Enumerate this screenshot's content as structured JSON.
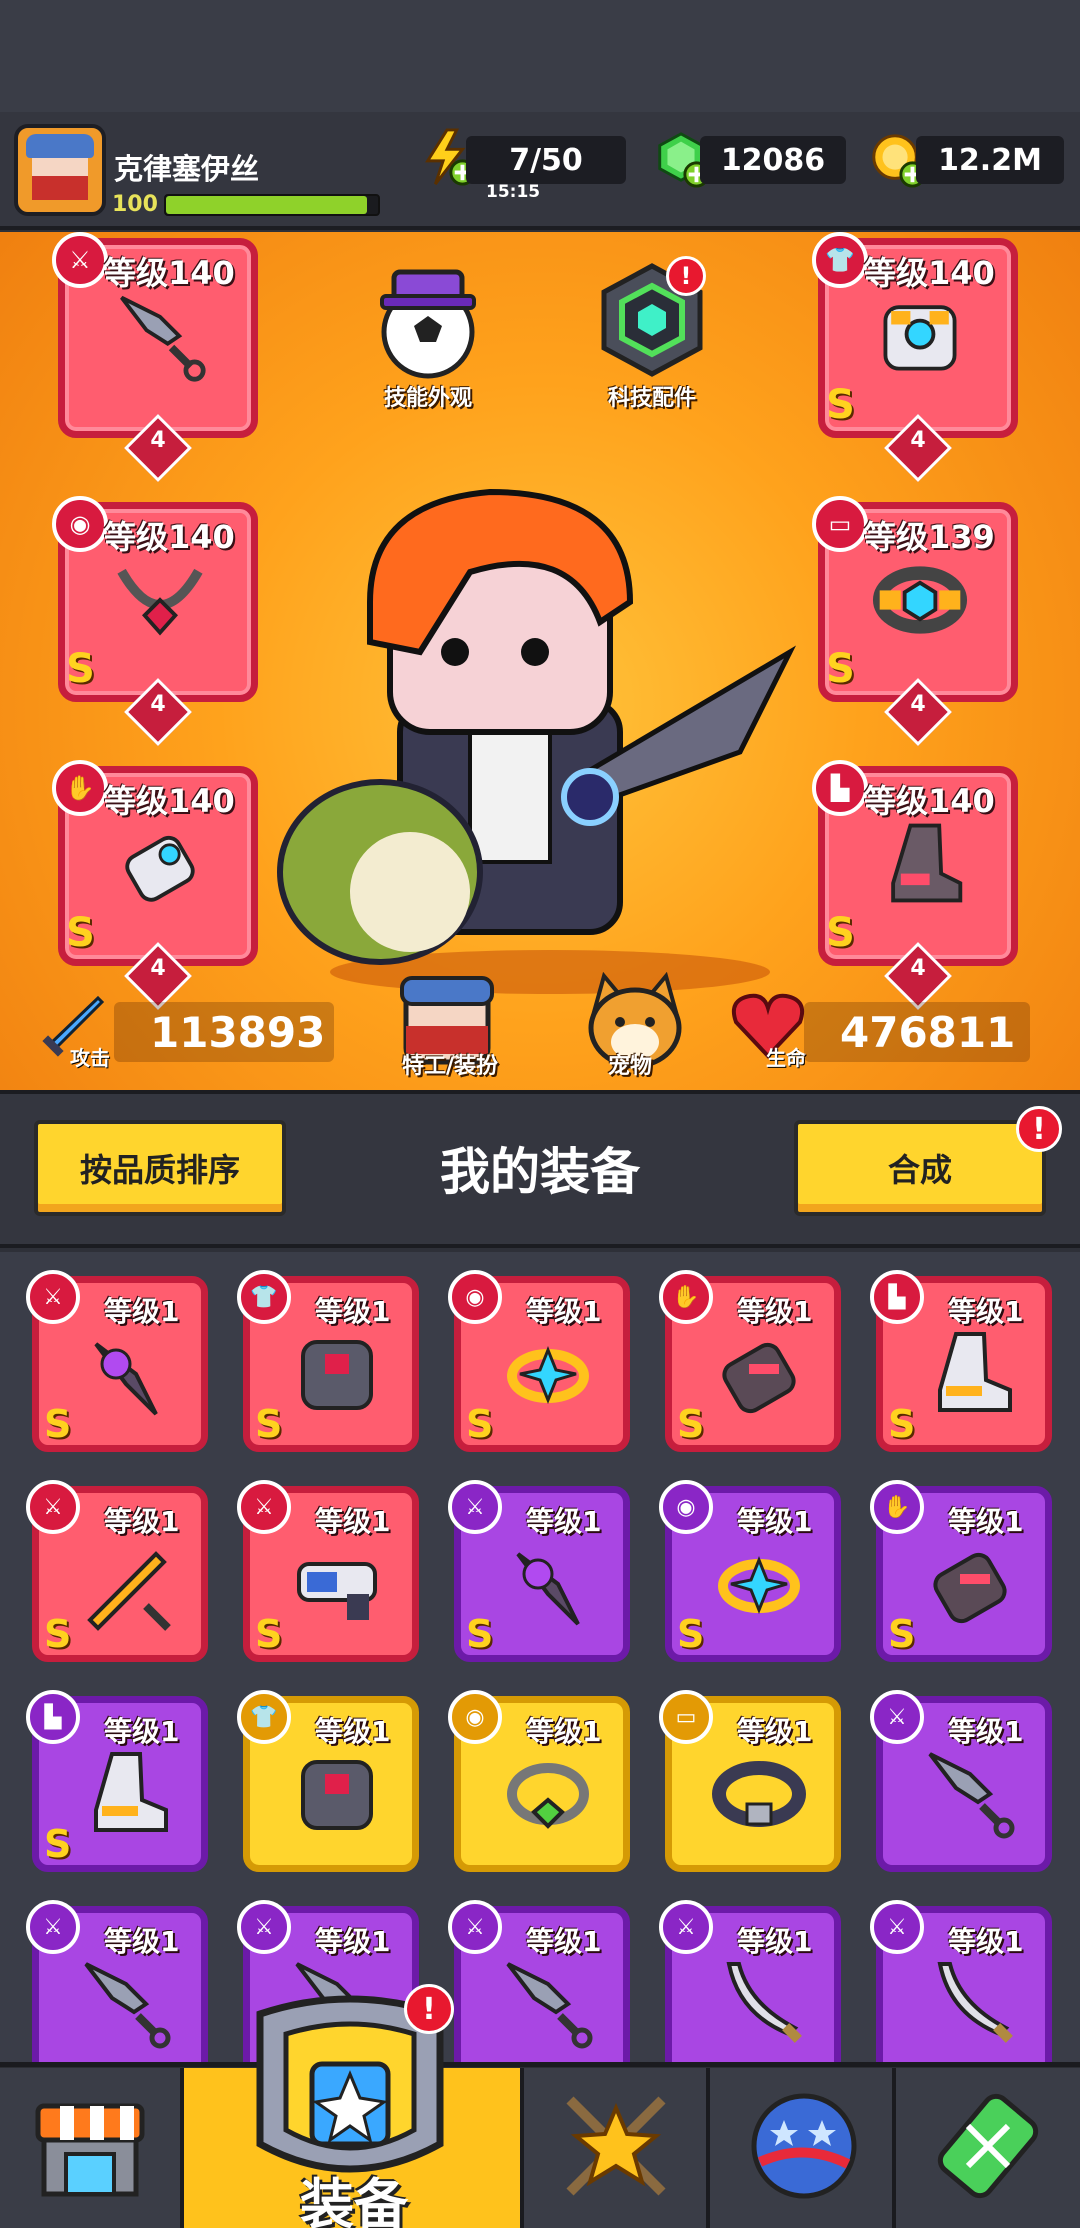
{
  "player": {
    "name": "克律塞伊丝",
    "level": "100",
    "xp_fraction": 0.95
  },
  "resources": {
    "energy": "7/50",
    "energy_timer": "15:15",
    "gems": "12086",
    "coins": "12.2M"
  },
  "equipped": [
    {
      "slot": "weapon",
      "level": "等级140",
      "grade": "",
      "stars": "4",
      "icon": "kunai-icon"
    },
    {
      "slot": "armor",
      "level": "等级140",
      "grade": "S",
      "stars": "4",
      "icon": "armor-icon"
    },
    {
      "slot": "necklace",
      "level": "等级140",
      "grade": "S",
      "stars": "4",
      "icon": "necklace-icon"
    },
    {
      "slot": "belt",
      "level": "等级139",
      "grade": "S",
      "stars": "4",
      "icon": "belt-icon"
    },
    {
      "slot": "gloves",
      "level": "等级140",
      "grade": "S",
      "stars": "4",
      "icon": "glove-icon"
    },
    {
      "slot": "boots",
      "level": "等级140",
      "grade": "S",
      "stars": "4",
      "icon": "boot-icon"
    }
  ],
  "center_buttons": {
    "skill_skin": "技能外观",
    "tech_parts": "科技配件",
    "agent_outfit": "特工/装扮",
    "pet": "宠物"
  },
  "stats": {
    "attack_label": "攻击",
    "attack": "113893",
    "hp_label": "生命",
    "hp": "476811"
  },
  "section": {
    "sort_button": "按品质排序",
    "title": "我的装备",
    "merge_button": "合成",
    "alert": "!"
  },
  "inventory": [
    {
      "rarity": "red",
      "level": "等级1",
      "grade": "S",
      "icon": "dagger-icon"
    },
    {
      "rarity": "red",
      "level": "等级1",
      "grade": "S",
      "icon": "armor-icon"
    },
    {
      "rarity": "red",
      "level": "等级1",
      "grade": "S",
      "icon": "ring-icon"
    },
    {
      "rarity": "red",
      "level": "等级1",
      "grade": "S",
      "icon": "glove-icon"
    },
    {
      "rarity": "red",
      "level": "等级1",
      "grade": "S",
      "icon": "boot-icon"
    },
    {
      "rarity": "red",
      "level": "等级1",
      "grade": "S",
      "icon": "sword-icon"
    },
    {
      "rarity": "red",
      "level": "等级1",
      "grade": "S",
      "icon": "blaster-icon"
    },
    {
      "rarity": "purple",
      "level": "等级1",
      "grade": "S",
      "icon": "dagger-icon"
    },
    {
      "rarity": "purple",
      "level": "等级1",
      "grade": "S",
      "icon": "ring-icon"
    },
    {
      "rarity": "purple",
      "level": "等级1",
      "grade": "S",
      "icon": "glove-icon"
    },
    {
      "rarity": "purple",
      "level": "等级1",
      "grade": "S",
      "icon": "boot-icon"
    },
    {
      "rarity": "yellow",
      "level": "等级1",
      "grade": "",
      "icon": "armor-icon"
    },
    {
      "rarity": "yellow",
      "level": "等级1",
      "grade": "",
      "icon": "necklace-icon"
    },
    {
      "rarity": "yellow",
      "level": "等级1",
      "grade": "",
      "icon": "belt-icon"
    },
    {
      "rarity": "purple",
      "level": "等级1",
      "grade": "",
      "icon": "kunai-icon"
    },
    {
      "rarity": "purple",
      "level": "等级1",
      "grade": "",
      "icon": "kunai-icon"
    },
    {
      "rarity": "purple",
      "level": "等级1",
      "grade": "",
      "icon": "kunai-icon"
    },
    {
      "rarity": "purple",
      "level": "等级1",
      "grade": "",
      "icon": "kunai-icon"
    },
    {
      "rarity": "purple",
      "level": "等级1",
      "grade": "",
      "icon": "scimitar-icon"
    },
    {
      "rarity": "purple",
      "level": "等级1",
      "grade": "",
      "icon": "scimitar-icon"
    }
  ],
  "nav": {
    "shop": "shop-icon",
    "equipment_label": "装备",
    "alert": "!",
    "challenge": "star-swords-icon",
    "world": "planet-icon",
    "lab": "dna-icon"
  },
  "colors": {
    "red": "#ff5d6f",
    "purple": "#a946e3",
    "yellow": "#ffd52d",
    "orange_bg": "#ffa21c"
  }
}
